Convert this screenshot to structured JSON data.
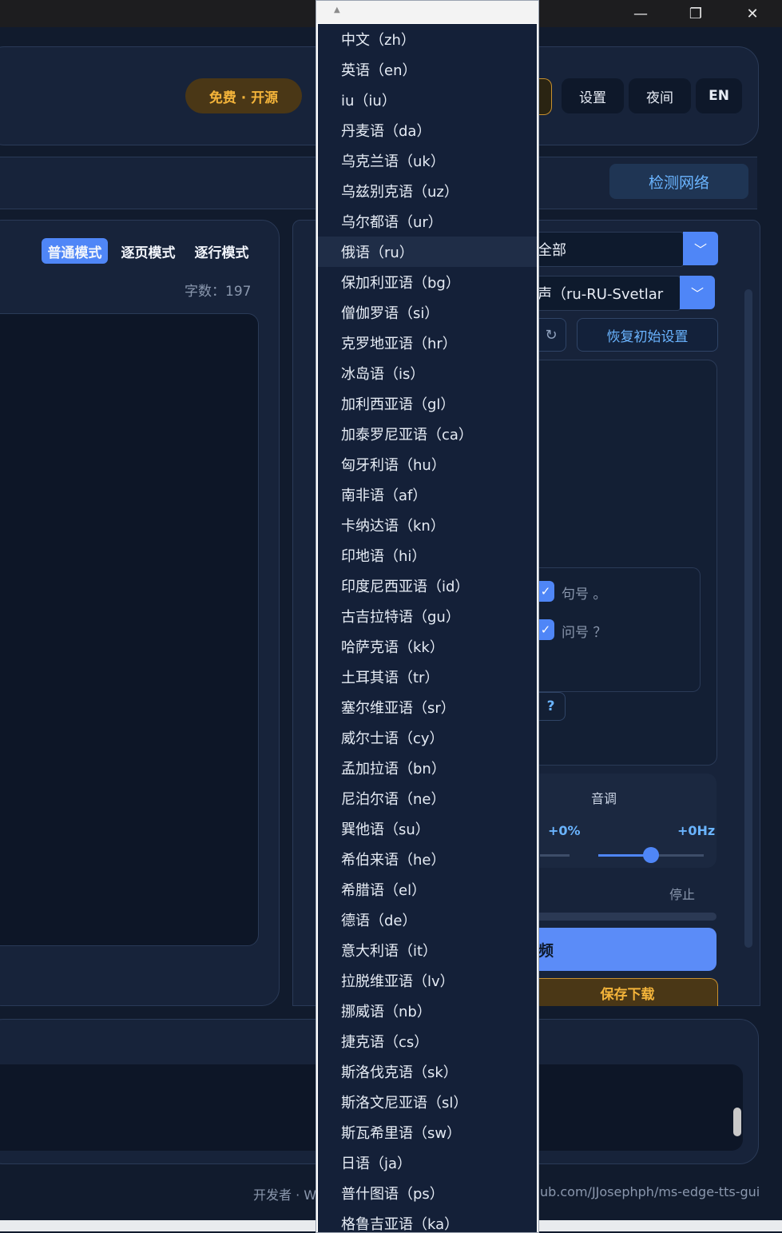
{
  "window": {
    "minimize_glyph": "—",
    "restore_glyph": "❐",
    "close_glyph": "✕"
  },
  "header": {
    "badge": "免费 · 开源",
    "settings": "设置",
    "night": "夜间",
    "lang": "EN"
  },
  "toolbar": {
    "detect_network": "检测网络"
  },
  "editor": {
    "modes": [
      "普通模式",
      "逐页模式",
      "逐行模式"
    ],
    "active_mode": "普通模式",
    "word_count": "字数：197"
  },
  "options": {
    "language_filter": "全部",
    "voice": "声（ru-RU-Svetlar",
    "restore_defaults": "恢复初始设置",
    "punctuation": [
      "句号 。",
      "问号 ？"
    ],
    "help": "?",
    "pitch_title": "音调",
    "rate_value": "+0%",
    "pitch_value": "+0Hz",
    "pitch_level": 0.5,
    "stop": "停止",
    "play_label": "频",
    "save_download": "保存下载"
  },
  "footer": {
    "left": "开发者 · W",
    "right": "ub.com/JJosephph/ms-edge-tts-gui"
  },
  "dropdown": {
    "scroll_up_glyph": "▲",
    "highlighted": "俄语（ru）",
    "items": [
      "中文（zh）",
      "英语（en）",
      "iu（iu）",
      "丹麦语（da）",
      "乌克兰语（uk）",
      "乌兹别克语（uz）",
      "乌尔都语（ur）",
      "俄语（ru）",
      "保加利亚语（bg）",
      "僧伽罗语（si）",
      "克罗地亚语（hr）",
      "冰岛语（is）",
      "加利西亚语（gl）",
      "加泰罗尼亚语（ca）",
      "匈牙利语（hu）",
      "南非语（af）",
      "卡纳达语（kn）",
      "印地语（hi）",
      "印度尼西亚语（id）",
      "古吉拉特语（gu）",
      "哈萨克语（kk）",
      "土耳其语（tr）",
      "塞尔维亚语（sr）",
      "威尔士语（cy）",
      "孟加拉语（bn）",
      "尼泊尔语（ne）",
      "巽他语（su）",
      "希伯来语（he）",
      "希腊语（el）",
      "德语（de）",
      "意大利语（it）",
      "拉脱维亚语（lv）",
      "挪威语（nb）",
      "捷克语（cs）",
      "斯洛伐克语（sk）",
      "斯洛文尼亚语（sl）",
      "斯瓦希里语（sw）",
      "日语（ja）",
      "普什图语（ps）",
      "格鲁吉亚语（ka）"
    ]
  }
}
